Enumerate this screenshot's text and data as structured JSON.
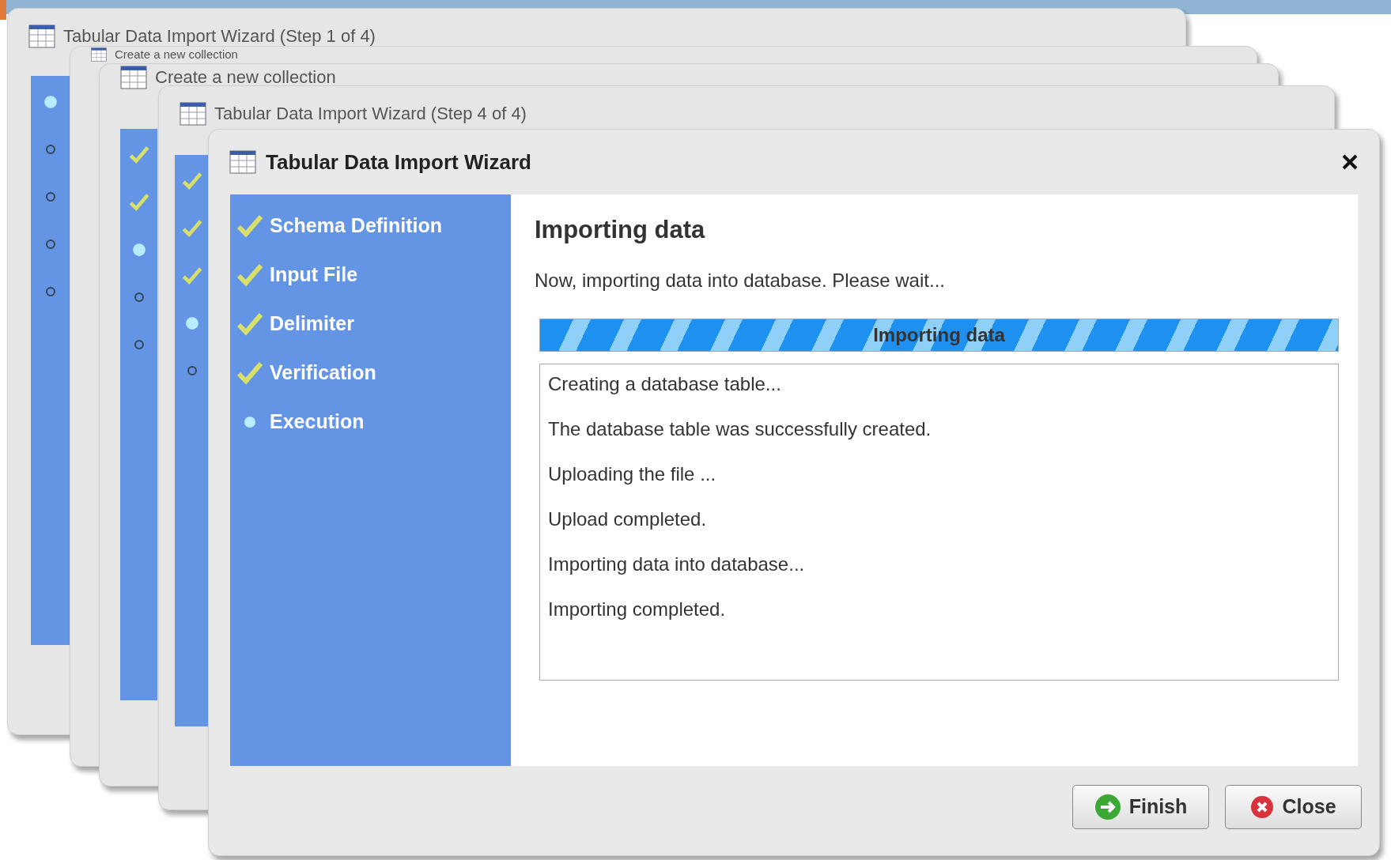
{
  "background_windows": [
    {
      "title": "Tabular Data Import Wizard (Step 1 of 4)",
      "steps": [
        {
          "checked": false,
          "selected": true
        },
        {
          "checked": false,
          "selected": false
        },
        {
          "checked": false,
          "selected": false
        },
        {
          "checked": false,
          "selected": false
        },
        {
          "checked": false,
          "selected": false
        }
      ]
    },
    {
      "title": "Create a new collection"
    },
    {
      "title": "Create a new collection",
      "steps": [
        {
          "checked": true,
          "selected": false
        },
        {
          "checked": true,
          "selected": false
        },
        {
          "checked": false,
          "selected": true
        },
        {
          "checked": false,
          "selected": false
        },
        {
          "checked": false,
          "selected": false
        }
      ]
    },
    {
      "title": "Tabular Data Import Wizard (Step 4 of 4)",
      "steps": [
        {
          "checked": true,
          "selected": false
        },
        {
          "checked": true,
          "selected": false
        },
        {
          "checked": true,
          "selected": false
        },
        {
          "checked": false,
          "selected": true
        },
        {
          "checked": false,
          "selected": false
        }
      ]
    }
  ],
  "window": {
    "title": "Tabular Data Import Wizard"
  },
  "steps": [
    {
      "label": "Schema Definition",
      "checked": true,
      "selected": false
    },
    {
      "label": "Input File",
      "checked": true,
      "selected": false
    },
    {
      "label": "Delimiter",
      "checked": true,
      "selected": false
    },
    {
      "label": "Verification",
      "checked": true,
      "selected": false
    },
    {
      "label": "Execution",
      "checked": false,
      "selected": true
    }
  ],
  "heading": "Importing data",
  "message": "Now, importing data into database. Please wait...",
  "progress": {
    "label": "Importing data",
    "level": 1
  },
  "log": [
    "Creating a database table...",
    "The database table was successfully created.",
    "Uploading the file ...",
    "Upload completed.",
    "Importing data into database...",
    "Importing completed."
  ],
  "buttons": [
    {
      "kind": "finish",
      "label": "Finish"
    },
    {
      "kind": "close",
      "label": "Close"
    }
  ]
}
